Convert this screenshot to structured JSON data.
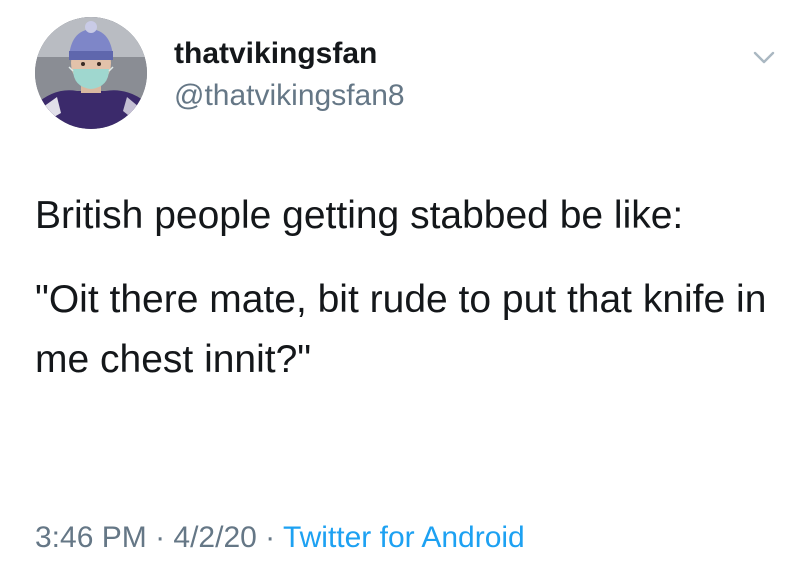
{
  "user": {
    "display_name": "thatvikingsfan",
    "handle": "@thatvikingsfan8",
    "avatar_icon": "profile-photo-masked-person-purple-beanie"
  },
  "tweet": {
    "line1": "British people getting stabbed be like:",
    "line2": "\"Oit there mate, bit rude to put that knife in me chest innit?\""
  },
  "meta": {
    "time": "3:46 PM",
    "separator1": " · ",
    "date": "4/2/20",
    "separator2": " · ",
    "source": "Twitter for Android"
  },
  "icons": {
    "menu": "chevron-down-icon"
  },
  "colors": {
    "text": "#14171a",
    "secondary": "#657786",
    "link": "#1da1f2",
    "caret": "#aab8c2"
  }
}
